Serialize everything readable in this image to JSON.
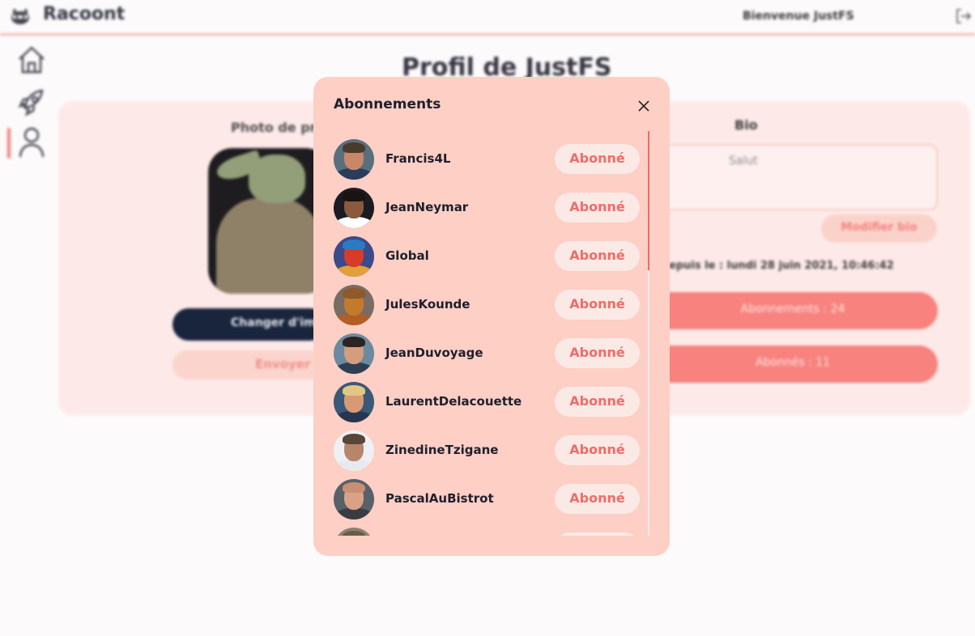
{
  "header": {
    "brand": "Racoont",
    "welcome": "Bienvenue JustFS",
    "logo_icon": "raccoon-icon",
    "logout_icon": "logout-icon"
  },
  "sidebar": {
    "items": [
      {
        "icon": "home-icon",
        "active": false
      },
      {
        "icon": "rocket-icon",
        "active": false
      },
      {
        "icon": "user-icon",
        "active": true
      }
    ]
  },
  "profile": {
    "title": "Profil de JustFS",
    "photo_label": "Photo de pr",
    "change_image_label": "Changer d'im",
    "send_label": "Envoyer",
    "bio_label": "Bio",
    "bio_text": "Salut",
    "edit_bio_label": "Modifier bio",
    "member_since": "epuis le : lundi 28 juin 2021, 10:46:42",
    "subscriptions_button": "Abonnements : 24",
    "followers_button": "Abonnés : 11"
  },
  "modal": {
    "title": "Abonnements",
    "close_icon": "close-icon",
    "follow_label": "Abonné",
    "users": [
      {
        "name": "Francis4L",
        "skin": "#c9876a",
        "hair": "#4a3a2e",
        "clothes": "#2b3b5c",
        "bg": "#5a6f7e"
      },
      {
        "name": "JeanNeymar",
        "skin": "#8a5a3d",
        "hair": "#1a1410",
        "clothes": "#ffffff",
        "bg": "#1b1b22"
      },
      {
        "name": "Global",
        "skin": "#d93b2a",
        "hair": "#2a7bc4",
        "clothes": "#e2a03b",
        "bg": "#3a4a8a"
      },
      {
        "name": "JulesKounde",
        "skin": "#c47a2c",
        "hair": "#8e5a2a",
        "clothes": "#b15f24",
        "bg": "#7a6c62"
      },
      {
        "name": "JeanDuvoyage",
        "skin": "#d59c7e",
        "hair": "#2b2420",
        "clothes": "#2d3f52",
        "bg": "#6b8aa0"
      },
      {
        "name": "LaurentDelacouette",
        "skin": "#d89a74",
        "hair": "#e3c683",
        "clothes": "#283650",
        "bg": "#3a5878"
      },
      {
        "name": "ZinedineTzigane",
        "skin": "#b6856a",
        "hair": "#5a4638",
        "clothes": "#e8e8ef",
        "bg": "#eef0f4"
      },
      {
        "name": "PascalAuBistrot",
        "skin": "#d9a286",
        "hair": "#c88f74",
        "clothes": "#3b3b44",
        "bg": "#58606a"
      },
      {
        "name": "",
        "skin": "#9b8a72",
        "hair": "#6a5a4a",
        "clothes": "#55504a",
        "bg": "#8a8270"
      }
    ]
  }
}
